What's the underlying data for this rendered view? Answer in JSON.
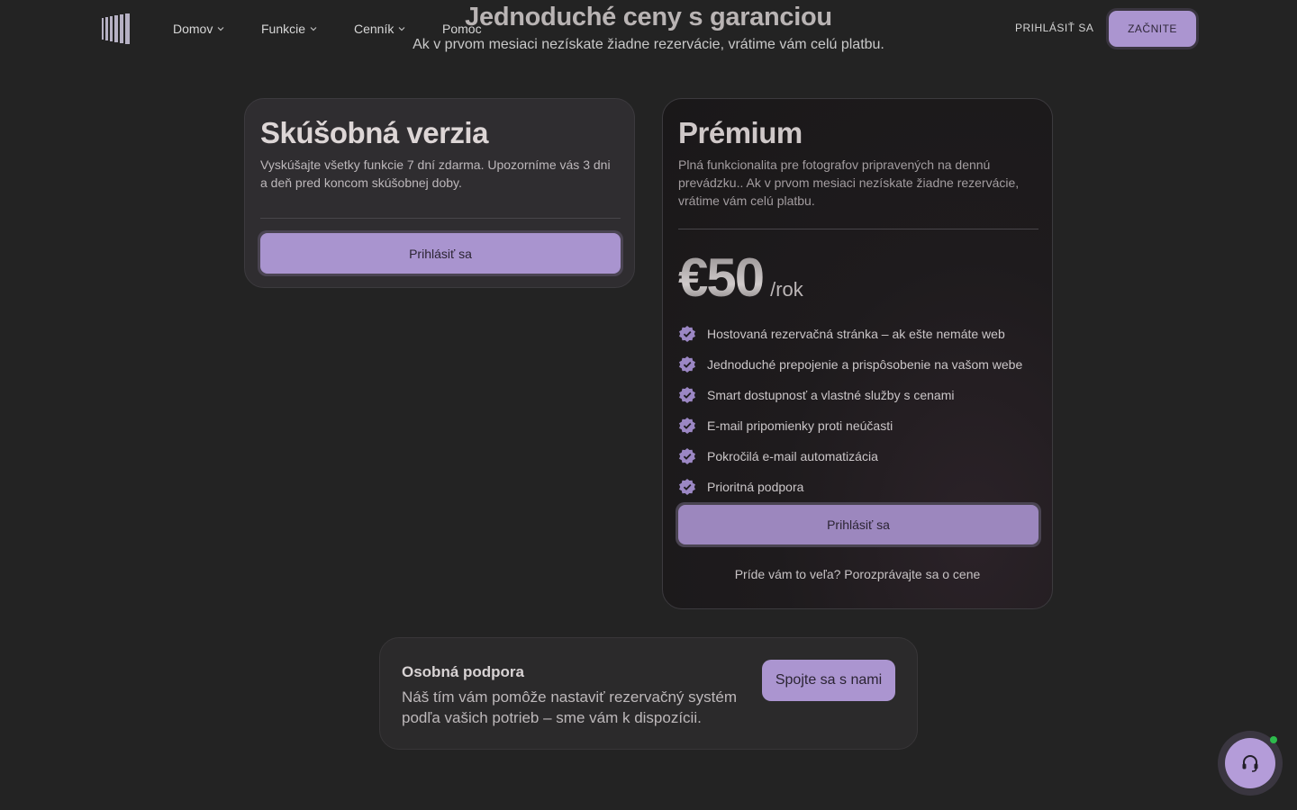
{
  "hero": {
    "title": "Jednoduché ceny s garanciou",
    "subtitle": "Ak v prvom mesiaci nezískate žiadne rezervácie, vrátime vám celú platbu."
  },
  "nav": {
    "logo_icon": "barcode-stripes-logo",
    "items": [
      "Domov",
      "Funkcie",
      "Cenník",
      "Pomoc"
    ],
    "login_label": "PRIHLÁSIŤ SA",
    "start_label": "ZAČNITE"
  },
  "plans": {
    "trial": {
      "title": "Skúšobná verzia",
      "description": "Vyskúšajte všetky funkcie 7 dní zdarma. Upozorníme vás 3 dni a deň pred koncom skúšobnej doby.",
      "button_label": "Prihlásiť sa"
    },
    "premium": {
      "title": "Prémium",
      "description": "Plná funkcionalita pre fotografov pripravených na dennú prevádzku.. Ak v prvom mesiaci nezískate žiadne rezervácie, vrátime vám celú platbu.",
      "price": "€50",
      "period": "/rok",
      "features": [
        "Hostovaná rezervačná stránka – ak ešte nemáte web",
        "Jednoduché prepojenie a prispôsobenie na vašom webe",
        "Smart dostupnosť a vlastné služby s cenami",
        "E-mail pripomienky proti neúčasti",
        "Pokročilá e-mail automatizácia",
        "Prioritná podpora"
      ],
      "button_label": "Prihlásiť sa",
      "discuss_text": "Príde vám to veľa? Porozprávajte sa o cene"
    }
  },
  "support": {
    "title": "Osobná podpora",
    "text": "Náš tím vám pomôže nastaviť rezervačný systém podľa vašich potrieb – sme vám k dispozícii.",
    "button_label": "Spojte sa s nami"
  },
  "chat": {
    "icon": "headset-icon",
    "status_color": "#2dbb4c"
  },
  "colors": {
    "accent": "#ab95d0",
    "background": "#232323"
  }
}
